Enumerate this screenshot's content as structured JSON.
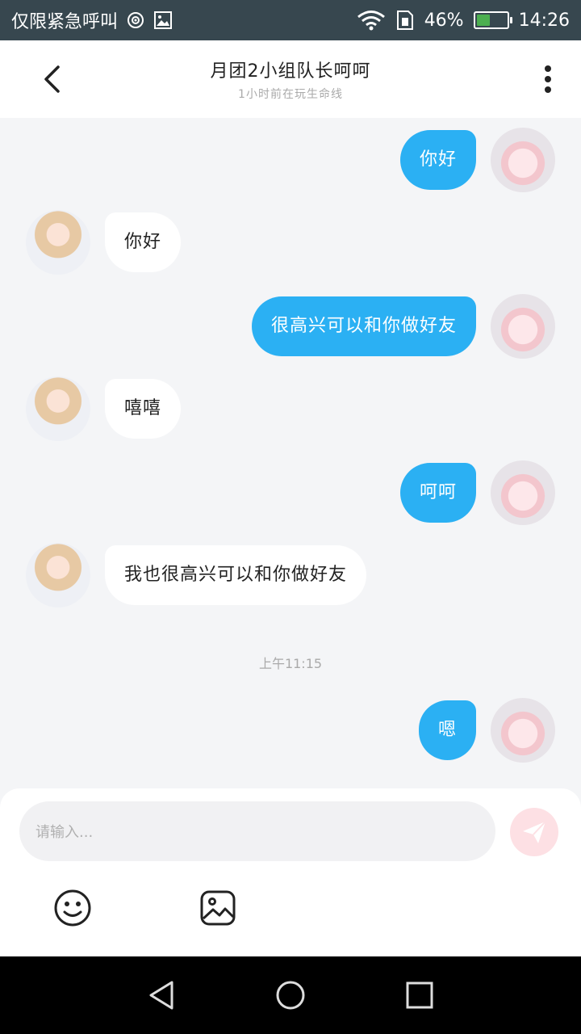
{
  "status_bar": {
    "carrier": "仅限紧急呼叫",
    "battery": "46%",
    "time": "14:26",
    "battery_level": 0.46
  },
  "header": {
    "title": "月团2小组队长呵呵",
    "subtitle": "1小时前在玩生命线"
  },
  "messages": [
    {
      "from": "self",
      "text": "你好"
    },
    {
      "from": "other",
      "text": "你好"
    },
    {
      "from": "self",
      "text": "很高兴可以和你做好友"
    },
    {
      "from": "other",
      "text": "嘻嘻"
    },
    {
      "from": "self",
      "text": "呵呵"
    },
    {
      "from": "other",
      "text": "我也很高兴可以和你做好友"
    },
    {
      "from": "self",
      "text": "嗯"
    }
  ],
  "timestamp": "上午11:15",
  "input": {
    "placeholder": "请输入..."
  },
  "icons": {
    "back": "chevron-left-icon",
    "more": "more-vertical-icon",
    "send": "send-icon",
    "emoji": "emoji-icon",
    "image": "image-icon"
  },
  "colors": {
    "accent": "#2bb0f3",
    "send_button": "#fde0e4",
    "status_bar": "#37474f"
  }
}
